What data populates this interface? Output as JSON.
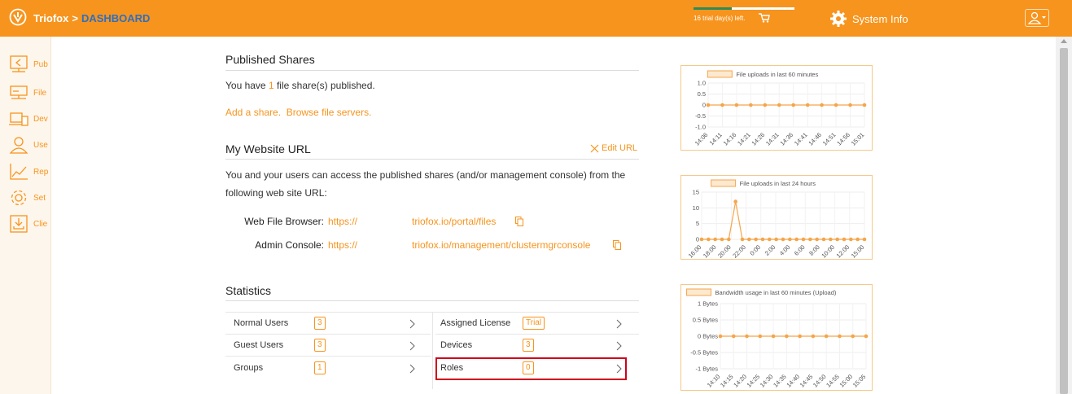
{
  "header": {
    "brand": "Triofox",
    "separator": ">",
    "page": "DASHBOARD",
    "trial_text": "16 trial day(s) left.",
    "trial_progress": 0.38,
    "system_info": "System Info",
    "accent": "#f7941d"
  },
  "sidebar": {
    "items": [
      {
        "label": "Pub",
        "icon": "published-shares-icon"
      },
      {
        "label": "File",
        "icon": "file-servers-icon"
      },
      {
        "label": "Dev",
        "icon": "devices-icon"
      },
      {
        "label": "Use",
        "icon": "users-icon"
      },
      {
        "label": "Rep",
        "icon": "reports-icon"
      },
      {
        "label": "Set",
        "icon": "settings-icon"
      },
      {
        "label": "Clie",
        "icon": "client-download-icon"
      }
    ]
  },
  "published": {
    "title": "Published Shares",
    "text_before": "You have ",
    "count": "1",
    "text_after": " file share(s) published.",
    "add_share": "Add a share.",
    "browse": "Browse file servers."
  },
  "website": {
    "title": "My Website URL",
    "edit": "Edit URL",
    "description_line1": "You and your users can access the published shares (and/or management console) from the",
    "description_line2": "following web site URL:",
    "web_label": "Web File Browser:",
    "web_url_start": "https://",
    "web_url_end": "triofox.io/portal/files",
    "admin_label": "Admin Console:",
    "admin_url_start": "https://",
    "admin_url_end": "triofox.io/management/clustermgrconsole"
  },
  "statistics": {
    "title": "Statistics",
    "left": [
      {
        "label": "Normal Users",
        "value": "3"
      },
      {
        "label": "Guest Users",
        "value": "3"
      },
      {
        "label": "Groups",
        "value": "1"
      }
    ],
    "right": [
      {
        "label": "Assigned License",
        "value": "Trial"
      },
      {
        "label": "Devices",
        "value": "3"
      },
      {
        "label": "Roles",
        "value": "0"
      }
    ]
  },
  "chart_data": [
    {
      "type": "line",
      "title": "File uploads in last 60 minutes",
      "x": [
        "14:06",
        "14:11",
        "14:16",
        "14:21",
        "14:26",
        "14:31",
        "14:36",
        "14:41",
        "14:46",
        "14:51",
        "14:56",
        "15:01"
      ],
      "series": [
        {
          "values": [
            0,
            0,
            0,
            0,
            0,
            0,
            0,
            0,
            0,
            0,
            0,
            0
          ]
        }
      ],
      "yticks": [
        "1.0",
        "0.5",
        "0",
        "-0.5",
        "-1.0"
      ],
      "ylim": [
        -1,
        1
      ],
      "color": "#f5a54a"
    },
    {
      "type": "line",
      "title": "File uploads in last 24 hours",
      "x": [
        "16:00",
        "18:00",
        "20:00",
        "22:00",
        "0:00",
        "2:00",
        "4:00",
        "6:00",
        "8:00",
        "10:00",
        "12:00",
        "15:00"
      ],
      "series": [
        {
          "values": [
            0,
            0,
            0,
            0,
            0,
            12,
            0,
            0,
            0,
            0,
            0,
            0,
            0,
            0,
            0,
            0,
            0,
            0,
            0,
            0,
            0,
            0,
            0,
            0,
            0
          ]
        }
      ],
      "yticks": [
        "15",
        "10",
        "5",
        "0"
      ],
      "ylim": [
        0,
        15
      ],
      "color": "#f5a54a"
    },
    {
      "type": "line",
      "title": "Bandwidth usage in last 60 minutes (Upload)",
      "x": [
        "14:10",
        "14:15",
        "14:20",
        "14:25",
        "14:30",
        "14:35",
        "14:40",
        "14:45",
        "14:50",
        "14:55",
        "15:00",
        "15:05"
      ],
      "series": [
        {
          "values": [
            0,
            0,
            0,
            0,
            0,
            0,
            0,
            0,
            0,
            0,
            0,
            0
          ]
        }
      ],
      "yticks": [
        "1 Bytes",
        "0.5 Bytes",
        "0 Bytes",
        "-0.5 Bytes",
        "-1 Bytes"
      ],
      "ylim": [
        -1,
        1
      ],
      "color": "#f5a54a"
    }
  ]
}
